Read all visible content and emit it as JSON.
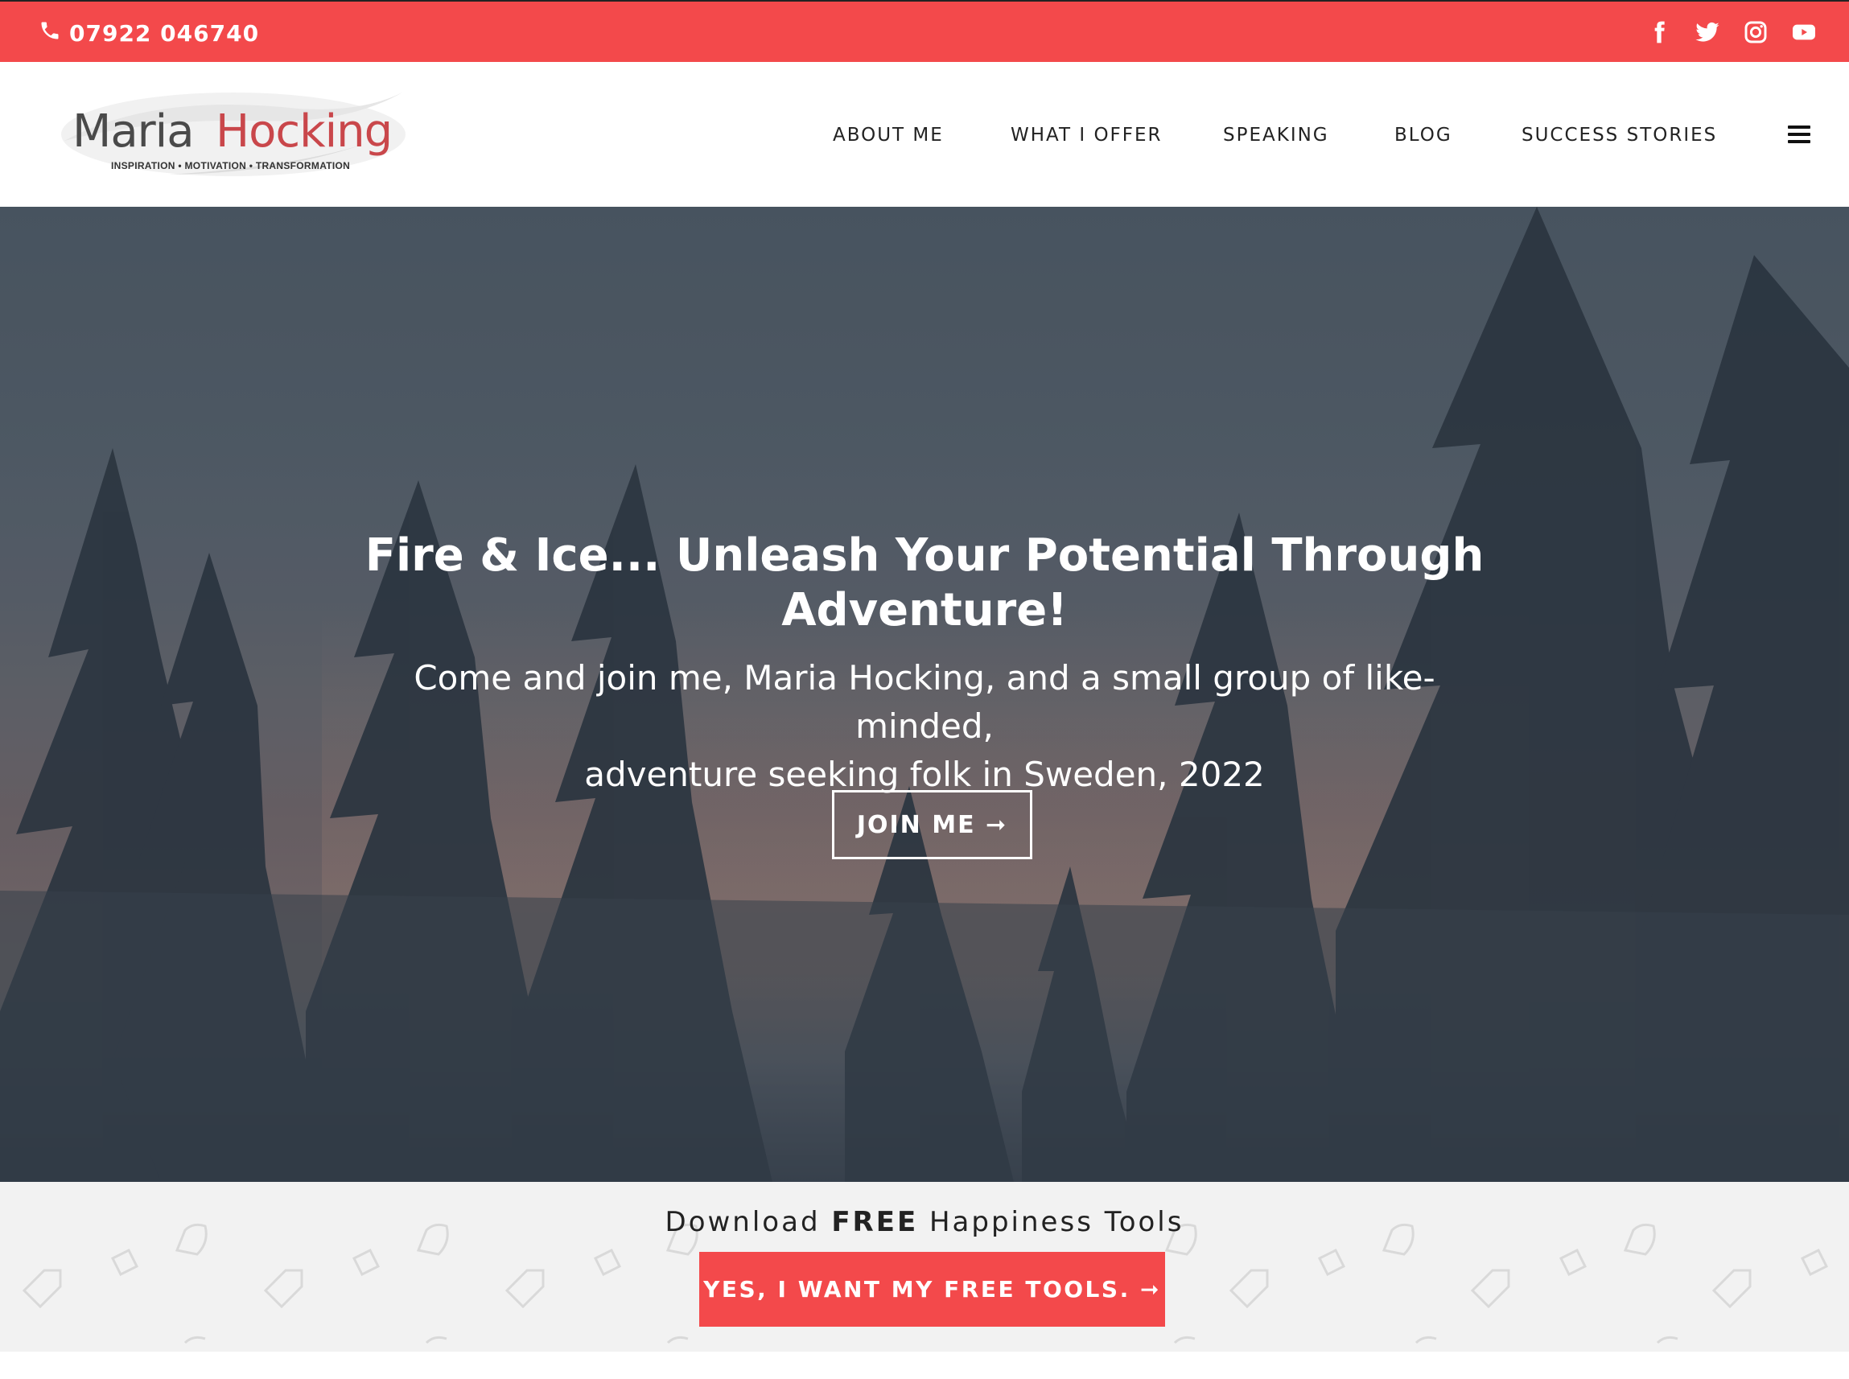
{
  "topbar": {
    "phone": "07922 046740",
    "social": [
      "facebook-icon",
      "twitter-icon",
      "instagram-icon",
      "youtube-icon"
    ]
  },
  "logo": {
    "first": "Maria",
    "last": "Hocking",
    "tagline": "INSPIRATION • MOTIVATION • TRANSFORMATION"
  },
  "nav": {
    "items": [
      "ABOUT ME",
      "WHAT I OFFER",
      "SPEAKING",
      "BLOG",
      "SUCCESS STORIES"
    ]
  },
  "hero": {
    "title_line1": "Fire & Ice... Unleash Your Potential Through",
    "title_line2": "Adventure!",
    "subtitle_line1": "Come and join me, Maria Hocking, and a small group of like-minded,",
    "subtitle_line2": "adventure seeking folk in Sweden, 2022",
    "button": "JOIN ME ➞"
  },
  "tools": {
    "text_before": "Download ",
    "text_bold": "FREE",
    "text_after": " Happiness Tools",
    "button": "YES, I WANT MY FREE TOOLS. ➞"
  },
  "colors": {
    "brand_red": "#f3494b",
    "logo_red": "#c9474b"
  }
}
